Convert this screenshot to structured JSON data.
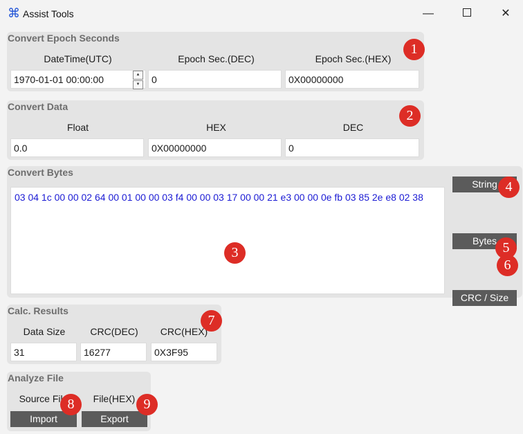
{
  "window": {
    "title": "Assist Tools",
    "minimize_glyph": "—",
    "close_glyph": "✕",
    "icon": "command-icon"
  },
  "epoch": {
    "title": "Convert Epoch Seconds",
    "datetime_label": "DateTime(UTC)",
    "dec_label": "Epoch Sec.(DEC)",
    "hex_label": "Epoch Sec.(HEX)",
    "datetime_value": "1970-01-01 00:00:00",
    "dec_value": "0",
    "hex_value": "0X00000000"
  },
  "convert_data": {
    "title": "Convert Data",
    "float_label": "Float",
    "hex_label": "HEX",
    "dec_label": "DEC",
    "float_value": "0.0",
    "hex_value": "0X00000000",
    "dec_value": "0"
  },
  "bytes": {
    "title": "Convert Bytes",
    "content": "03 04 1c 00 00 02 64 00 01 00 00 03 f4 00 00 03 17 00 00 21 e3 00 00 0e fb 03 85 2e e8 02 38",
    "string_button": "String",
    "bytes_button": "Bytes",
    "crc_button": "CRC / Size"
  },
  "results": {
    "title": "Calc. Results",
    "size_label": "Data Size",
    "crc_dec_label": "CRC(DEC)",
    "crc_hex_label": "CRC(HEX)",
    "size_value": "31",
    "crc_dec_value": "16277",
    "crc_hex_value": "0X3F95"
  },
  "analyze": {
    "title": "Analyze File",
    "source_label": "Source File",
    "file_hex_label": "File(HEX)",
    "import_button": "Import",
    "export_button": "Export"
  },
  "badges": [
    "1",
    "2",
    "3",
    "4",
    "5",
    "6",
    "7",
    "8",
    "9"
  ]
}
